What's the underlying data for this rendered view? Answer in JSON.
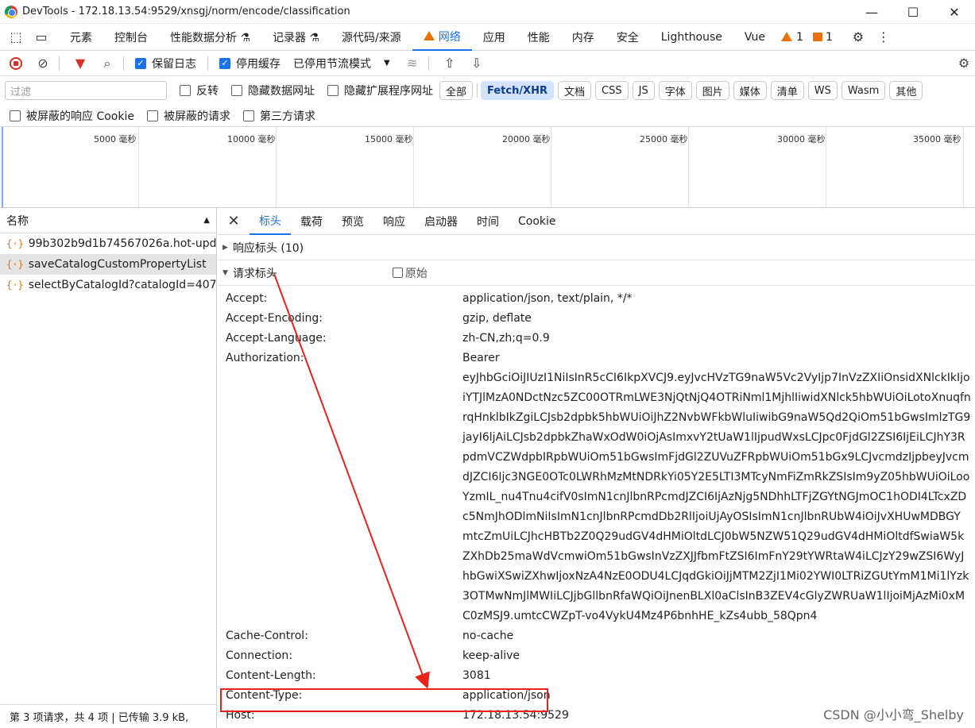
{
  "window": {
    "title": "DevTools - 172.18.13.54:9529/xnsgj/norm/encode/classification",
    "controls": [
      "—",
      "☐",
      "✕"
    ]
  },
  "panel_tabs": [
    {
      "label": "元素",
      "active": false
    },
    {
      "label": "控制台",
      "active": false
    },
    {
      "label": "性能数据分析 ⚗",
      "active": false
    },
    {
      "label": "记录器 ⚗",
      "active": false
    },
    {
      "label": "源代码/来源",
      "active": false
    },
    {
      "label": "网络",
      "active": true,
      "warning": true
    },
    {
      "label": "应用",
      "active": false
    },
    {
      "label": "性能",
      "active": false
    },
    {
      "label": "内存",
      "active": false
    },
    {
      "label": "安全",
      "active": false
    },
    {
      "label": "Lighthouse",
      "active": false
    },
    {
      "label": "Vue",
      "active": false
    }
  ],
  "issues": {
    "warnings": "1",
    "errors": "1"
  },
  "toolbar": {
    "preserve_log": "保留日志",
    "disable_cache": "停用缓存",
    "throttle": "已停用节流模式"
  },
  "filter": {
    "placeholder": "过滤",
    "invert": "反转",
    "hide_data_urls": "隐藏数据网址",
    "hide_ext_urls": "隐藏扩展程序网址",
    "types": [
      "全部",
      "Fetch/XHR",
      "文档",
      "CSS",
      "JS",
      "字体",
      "图片",
      "媒体",
      "清单",
      "WS",
      "Wasm",
      "其他"
    ],
    "active_type": "Fetch/XHR"
  },
  "options": {
    "blocked_cookies": "被屏蔽的响应 Cookie",
    "blocked_requests": "被屏蔽的请求",
    "third_party": "第三方请求"
  },
  "timeline": {
    "ticks": [
      "5000 毫秒",
      "10000 毫秒",
      "15000 毫秒",
      "20000 毫秒",
      "25000 毫秒",
      "30000 毫秒",
      "35000 毫秒"
    ]
  },
  "requests": {
    "header": "名称",
    "items": [
      {
        "name": "99b302b9d1b74567026a.hot-upd...",
        "selected": false
      },
      {
        "name": "saveCatalogCustomPropertyList",
        "selected": true
      },
      {
        "name": "selectByCatalogId?catalogId=407...",
        "selected": false
      }
    ],
    "footer": "第 3 项请求，共 4 项  |  已传输 3.9 kB,"
  },
  "detail": {
    "tabs": [
      {
        "label": "标头",
        "active": true
      },
      {
        "label": "载荷",
        "active": false
      },
      {
        "label": "预览",
        "active": false
      },
      {
        "label": "响应",
        "active": false
      },
      {
        "label": "启动器",
        "active": false
      },
      {
        "label": "时间",
        "active": false
      },
      {
        "label": "Cookie",
        "active": false
      }
    ],
    "response_headers": "响应标头 (10)",
    "request_headers": "请求标头",
    "raw": "原始",
    "headers": [
      {
        "k": "Accept:",
        "v": "application/json, text/plain, */*"
      },
      {
        "k": "Accept-Encoding:",
        "v": "gzip, deflate"
      },
      {
        "k": "Accept-Language:",
        "v": "zh-CN,zh;q=0.9"
      },
      {
        "k": "Authorization:",
        "v": "Bearer"
      },
      {
        "k": "",
        "v": "eyJhbGciOiJIUzI1NiIsInR5cCI6IkpXVCJ9.eyJvcHVzTG9naW5Vc2VyIjp7InVzZXIiOnsidXNlckIkIjoiYTJlMzA0NDctNzc5ZC00OTRmLWE3NjQtNjQ4OTRiNml1MjhlIiwidXNlck5hbWUiOiLotoXnuqfnrqHnklbIkZgiLCJsb2dpbk5hbWUiOiJhZ2NvbWFkbWluIiwibG9naW5Qd2QiOm51bGwsImlzTG9jayI6ljAiLCJsb2dpbkZhaWxOdW0iOjAsImxvY2tUaW1lIjpudWxsLCJpc0FjdGl2ZSI6IjEiLCJhY3RpdmVCZWdpbIRpbWUiOm51bGwsImFjdGl2ZUVuZFRpbWUiOm51bGx9LCJvcmdzIjpbeyJvcmdJZCI6Ijc3NGE0OTc0LWRhMzMtNDRkYi05Y2E5LTI3MTcyNmFiZmRkZSIsIm9yZ05hbWUiOiLooYzmIL_nu4Tnu4cifV0sImN1cnJlbnRPcmdJZCI6IjAzNjg5NDhhLTFjZGYtNGJmOC1hODI4LTcxZDc5NmJhODlmNiIsImN1cnJlbnRPcmdDb2RlIjoiUjAyOSIsImN1cnJlbnRUbW4iOiJvXHUwMDBGYmtcZmUiLCJhcHBTb2Z0Q29udGV4dHMiOltdLCJ0bW5NZW51Q29udGV4dHMiOltdfSwiaW5kZXhDb25maWdVcmwiOm51bGwsInVzZXJJfbmFtZSI6ImFnY29tYWRtaW4iLCJzY29wZSI6WyJhbGwiXSwiZXhwIjoxNzA4NzE0ODU4LCJqdGkiOiJjMTM2ZjI1Mi02YWI0LTRiZGUtYmM1Mi1lYzk3OTMwNmJlMWIiLCJjbGllbnRfaWQiOiJnenBLXl0aClsInB3ZEV4cGlyZWRUaW1lIjoiMjAzMi0xMC0zMSJ9.umtcCWZpT-vo4VykU4Mz4P6bnhHE_kZs4ubb_58Qpn4"
      },
      {
        "k": "Cache-Control:",
        "v": "no-cache"
      },
      {
        "k": "Connection:",
        "v": "keep-alive"
      },
      {
        "k": "Content-Length:",
        "v": "3081"
      },
      {
        "k": "Content-Type:",
        "v": "application/json"
      },
      {
        "k": "Host:",
        "v": "172.18.13.54:9529"
      }
    ]
  },
  "watermark": "CSDN @小小弯_Shelby",
  "colors": {
    "accent": "#1a73e8",
    "highlight": "#e8231a",
    "xhr_icon": "#e8710a"
  }
}
